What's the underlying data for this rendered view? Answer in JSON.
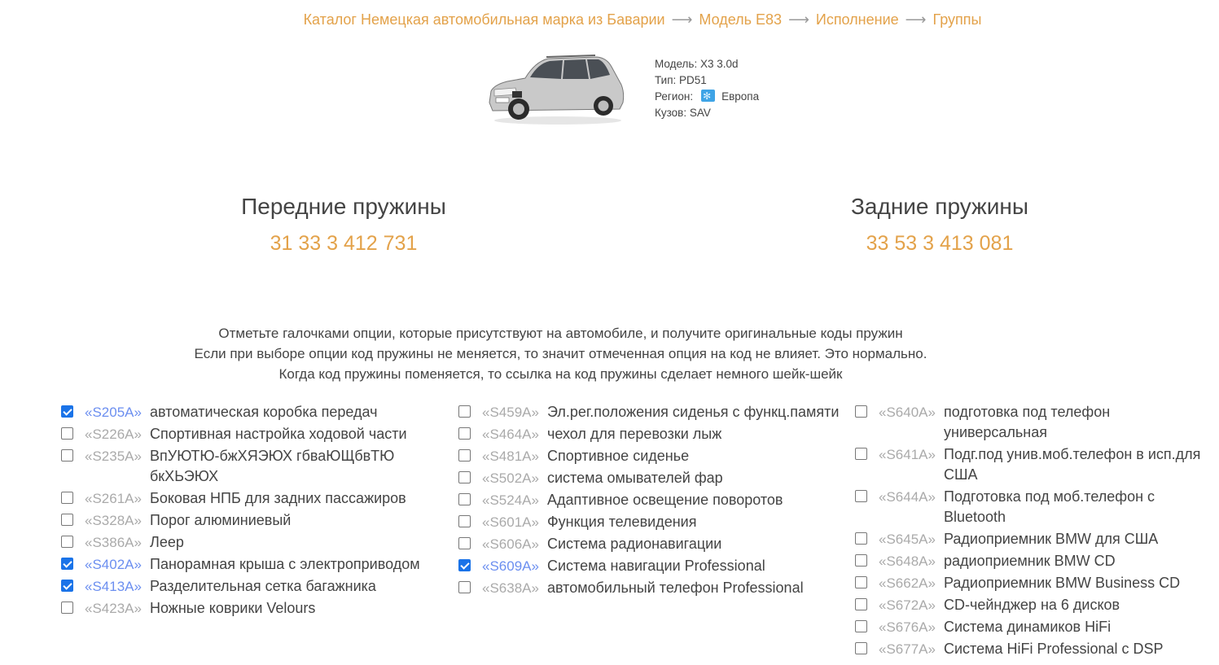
{
  "breadcrumb": {
    "items": [
      "Каталог Немецкая автомобильная марка из Баварии",
      "Модель E83",
      "Исполнение",
      "Группы"
    ],
    "separator": "⟶"
  },
  "car": {
    "model_label": "Модель:",
    "model_value": "X3 3.0d",
    "type_label": "Тип:",
    "type_value": "PD51",
    "region_label": "Регион:",
    "region_value": "Европа",
    "body_label": "Кузов:",
    "body_value": "SAV"
  },
  "springs": {
    "front": {
      "title": "Передние пружины",
      "code": "31 33 3 412 731"
    },
    "rear": {
      "title": "Задние пружины",
      "code": "33 53 3 413 081"
    }
  },
  "instructions": [
    "Отметьте галочками опции, которые присутствуют на автомобиле, и получите оригинальные коды пружин",
    "Если при выборе опции код пружины не меняется, то значит отмеченная опция на код не влияет. Это нормально.",
    "Когда код пружины поменяется, то ссылка на код пружины сделает немного шейк-шейк"
  ],
  "options": {
    "col1": [
      {
        "code": "«S205A»",
        "label": "автоматическая коробка передач",
        "checked": true
      },
      {
        "code": "«S226A»",
        "label": "Спортивная настройка ходовой части",
        "checked": false
      },
      {
        "code": "«S235A»",
        "label": "ВпУЮТЮ-бжХЯЭЮХ гбваЮЩбвТЮ бкХЬЭЮХ",
        "checked": false
      },
      {
        "code": "«S261A»",
        "label": "Боковая НПБ для задних пассажиров",
        "checked": false
      },
      {
        "code": "«S328A»",
        "label": "Порог алюминиевый",
        "checked": false
      },
      {
        "code": "«S386A»",
        "label": "Леер",
        "checked": false
      },
      {
        "code": "«S402A»",
        "label": "Панорамная крыша с электроприводом",
        "checked": true
      },
      {
        "code": "«S413A»",
        "label": "Разделительная сетка багажника",
        "checked": true
      },
      {
        "code": "«S423A»",
        "label": "Ножные коврики Velours",
        "checked": false
      }
    ],
    "col2": [
      {
        "code": "«S459A»",
        "label": "Эл.рег.положения сиденья с функц.памяти",
        "checked": false
      },
      {
        "code": "«S464A»",
        "label": "чехол для перевозки лыж",
        "checked": false
      },
      {
        "code": "«S481A»",
        "label": "Спортивное сиденье",
        "checked": false
      },
      {
        "code": "«S502A»",
        "label": "система омывателей фар",
        "checked": false
      },
      {
        "code": "«S524A»",
        "label": "Адаптивное освещение поворотов",
        "checked": false
      },
      {
        "code": "«S601A»",
        "label": "Функция телевидения",
        "checked": false
      },
      {
        "code": "«S606A»",
        "label": "Система радионавигации",
        "checked": false
      },
      {
        "code": "«S609A»",
        "label": "Система навигации Professional",
        "checked": true
      },
      {
        "code": "«S638A»",
        "label": "автомобильный телефон Professional",
        "checked": false
      }
    ],
    "col3": [
      {
        "code": "«S640A»",
        "label": "подготовка под телефон универсальная",
        "checked": false
      },
      {
        "code": "«S641A»",
        "label": "Подг.под унив.моб.телефон в исп.для США",
        "checked": false
      },
      {
        "code": "«S644A»",
        "label": "Подготовка под моб.телефон с Bluetooth",
        "checked": false
      },
      {
        "code": "«S645A»",
        "label": "Радиоприемник BMW для США",
        "checked": false
      },
      {
        "code": "«S648A»",
        "label": "радиоприемник BMW CD",
        "checked": false
      },
      {
        "code": "«S662A»",
        "label": "Радиоприемник BMW Business CD",
        "checked": false
      },
      {
        "code": "«S672A»",
        "label": "CD-чейнджер на 6 дисков",
        "checked": false
      },
      {
        "code": "«S676A»",
        "label": "Система динамиков HiFi",
        "checked": false
      },
      {
        "code": "«S677A»",
        "label": "Система HiFi Professional с DSP",
        "checked": false
      }
    ]
  }
}
